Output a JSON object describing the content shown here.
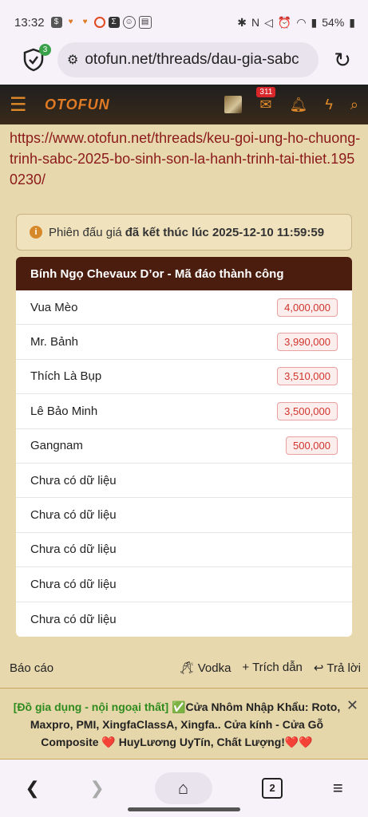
{
  "status_bar": {
    "time": "13:32",
    "battery": "54%"
  },
  "browser": {
    "url": "otofun.net/threads/dau-gia-sabc",
    "shield_count": "3",
    "tab_count": "2"
  },
  "site": {
    "logo": "OTOFUN",
    "notification_count": "311"
  },
  "content": {
    "link": "https://www.otofun.net/threads/keu-goi-ung-ho-chuong-trinh-sabc-2025-bo-sinh-son-la-hanh-trinh-tai-thiet.1950230/",
    "notice_prefix": "Phiên đấu giá",
    "notice_bold": "đã kết thúc lúc 2025-12-10 11:59:59",
    "bid_title": "Bính Ngọ Chevaux D’or - Mã đáo thành công",
    "bids": [
      {
        "name": "Vua Mèo",
        "amount": "4,000,000"
      },
      {
        "name": "Mr. Bảnh",
        "amount": "3,990,000"
      },
      {
        "name": "Thích Là Bụp",
        "amount": "3,510,000"
      },
      {
        "name": "Lê Bảo Minh",
        "amount": "3,500,000"
      },
      {
        "name": "Gangnam",
        "amount": "500,000"
      },
      {
        "name": "Chưa có dữ liệu",
        "amount": ""
      },
      {
        "name": "Chưa có dữ liệu",
        "amount": ""
      },
      {
        "name": "Chưa có dữ liệu",
        "amount": ""
      },
      {
        "name": "Chưa có dữ liệu",
        "amount": ""
      },
      {
        "name": "Chưa có dữ liệu",
        "amount": ""
      }
    ],
    "actions": {
      "report": "Báo cáo",
      "like": "Vodka",
      "quote": "+ Trích dẫn",
      "reply": "Trả lời"
    }
  },
  "ad": {
    "green": "[Đồ gia dụng - nội ngoại thất]",
    "text": "✅Cửa Nhôm Nhập Khẩu: Roto, Maxpro, PMI, XingfaClassA, Xingfa.. Cửa kính - Cửa Gỗ Composite ❤️ HuyLương UyTín, Chất Lượng!❤️❤️"
  }
}
